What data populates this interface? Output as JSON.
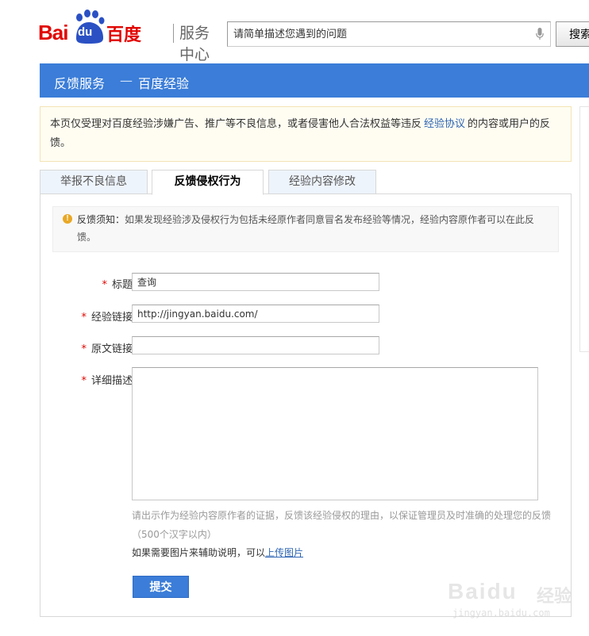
{
  "header": {
    "logo_bai": "Bai",
    "logo_du": "du",
    "logo_cn": "百度",
    "service_center": "服务中心",
    "search_placeholder": "请简单描述您遇到的问题",
    "search_button": "搜索"
  },
  "title_bar": {
    "section": "反馈服务",
    "separator": "—",
    "product": "百度经验"
  },
  "notice": {
    "text_before": "本页仅受理对百度经验涉嫌广告、推广等不良信息，或者侵害他人合法权益等违反",
    "link": "经验协议",
    "text_after": "的内容或用户的反馈。"
  },
  "tabs": [
    {
      "label": "举报不良信息",
      "active": false
    },
    {
      "label": "反馈侵权行为",
      "active": true
    },
    {
      "label": "经验内容修改",
      "active": false
    }
  ],
  "tip": {
    "label": "反馈须知：",
    "text": "如果发现经验涉及侵权行为包括未经原作者同意冒名发布经验等情况，经验内容原作者可以在此反馈。"
  },
  "form": {
    "required_mark": "*",
    "title_label": "标题：",
    "title_value": "查询",
    "link_label": "经验链接：",
    "link_value": "http://jingyan.baidu.com/",
    "original_label": "原文链接：",
    "original_value": "",
    "desc_label": "详细描述：",
    "desc_value": "",
    "hint": "请出示作为经验内容原作者的证据，反馈该经验侵权的理由，以保证管理员及时准确的处理您的反馈",
    "hint_limit": "（500个汉字以内）",
    "upload_text": "如果需要图片来辅助说明，可以",
    "upload_link": "上传图片",
    "submit_label": "提交"
  },
  "watermark": {
    "logo": "Baidu",
    "cn": "经验",
    "url": "jingyan.baidu.com"
  },
  "colors": {
    "brand_red": "#e10602",
    "title_blue": "#3b7dd8",
    "link_blue": "#2d64b3",
    "notice_bg": "#fffdf2"
  }
}
